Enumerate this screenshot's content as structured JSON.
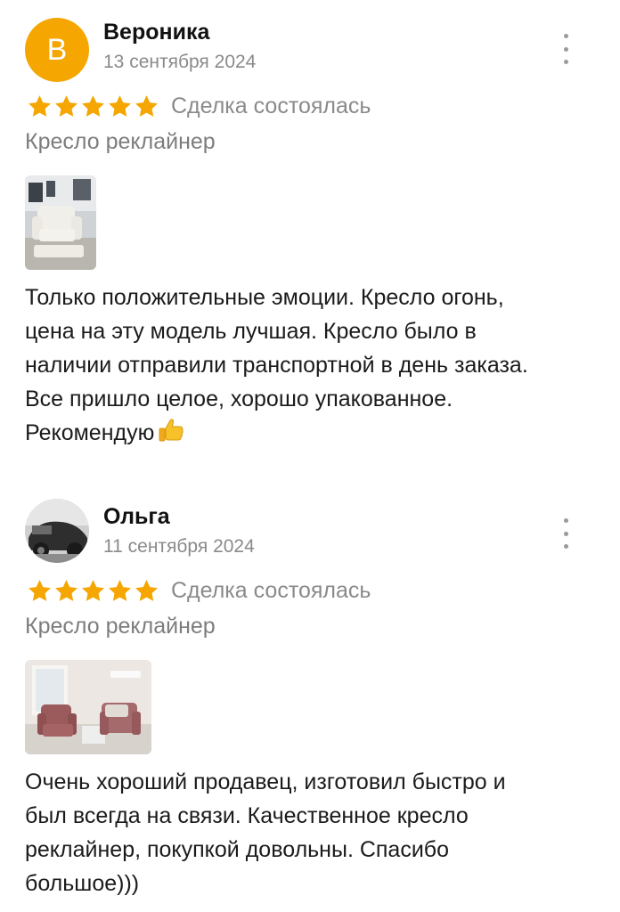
{
  "reviews": [
    {
      "author": "Вероника",
      "avatar_letter": "В",
      "avatar_color": "#f5a600",
      "date": "13 сентября 2024",
      "rating": 5,
      "deal_status": "Сделка состоялась",
      "product": "Кресло реклайнер",
      "text_lines": [
        "Только положительные эмоции. Кресло огонь,",
        "цена на эту модель лучшая. Кресло было в",
        "наличии отправили транспортной в день заказа.",
        "Все пришло целое, хорошо упакованное.",
        "Рекомендую"
      ],
      "emoji": "thumbs-up"
    },
    {
      "author": "Ольга",
      "date": "11 сентября 2024",
      "rating": 5,
      "deal_status": "Сделка состоялась",
      "product": "Кресло реклайнер",
      "text_lines": [
        "Очень хороший продавец, изготовил быстро и",
        "был всегда на связи. Качественное кресло",
        "реклайнер, покупкой довольны. Спасибо",
        "большое)))"
      ]
    }
  ],
  "colors": {
    "star": "#f5a600",
    "muted_text": "#8a8a8a"
  }
}
